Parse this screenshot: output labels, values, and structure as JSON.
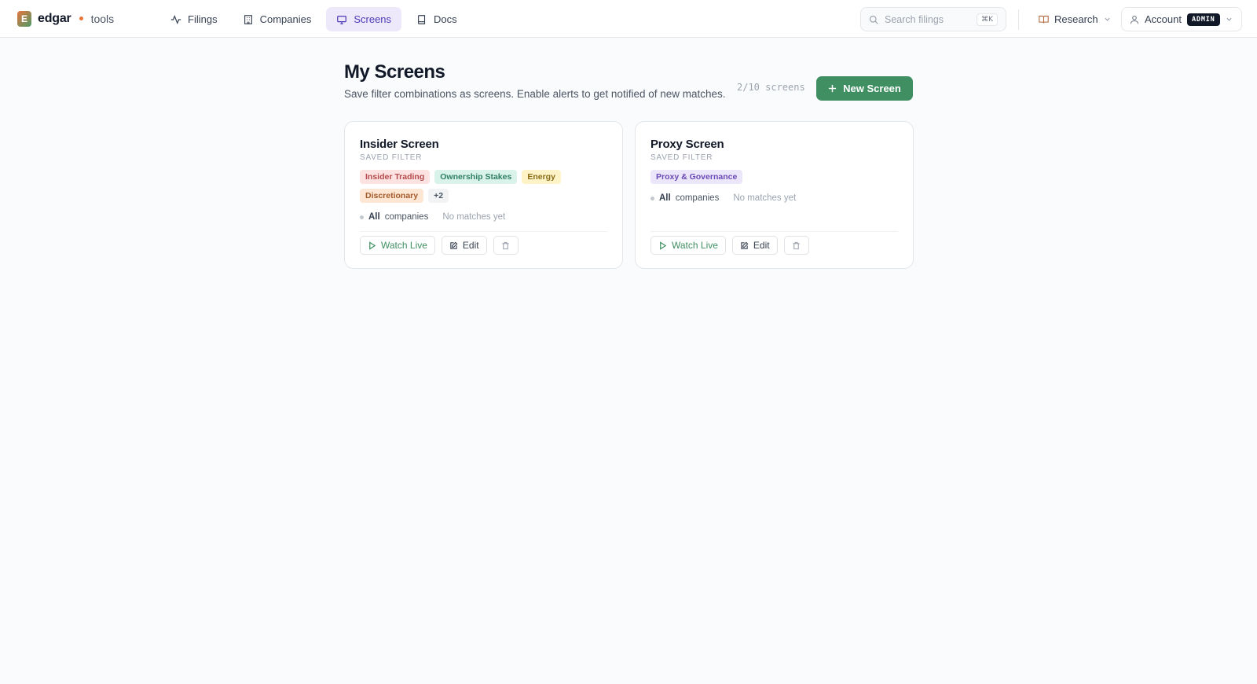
{
  "brand": {
    "mark": "E",
    "name": "edgar",
    "sub": "tools",
    "accent": "#e8743b"
  },
  "nav": {
    "items": [
      {
        "label": "Filings",
        "icon": "activity-icon"
      },
      {
        "label": "Companies",
        "icon": "building-icon"
      },
      {
        "label": "Screens",
        "icon": "monitor-icon",
        "active": true
      },
      {
        "label": "Docs",
        "icon": "book-icon"
      }
    ],
    "active_color": "#4c3ab7"
  },
  "search": {
    "placeholder": "Search filings",
    "shortcut": "⌘K"
  },
  "research": {
    "label": "Research"
  },
  "account": {
    "label": "Account",
    "badge": "ADMIN"
  },
  "page": {
    "title": "My Screens",
    "subtitle": "Save filter combinations as screens. Enable alerts to get notified of new matches.",
    "count": "2/10 screens",
    "new_button": "New Screen",
    "button_color": "#3f8f62"
  },
  "cards": [
    {
      "title": "Insider Screen",
      "kicker": "SAVED FILTER",
      "tags": [
        "Insider Trading",
        "Ownership Stakes",
        "Energy",
        "Discretionary",
        "+2"
      ],
      "scope_bold": "All",
      "scope_rest": "companies",
      "matches": "No matches yet",
      "watch_label": "Watch Live",
      "edit_label": "Edit"
    },
    {
      "title": "Proxy Screen",
      "kicker": "SAVED FILTER",
      "tags": [
        "Proxy & Governance"
      ],
      "scope_bold": "All",
      "scope_rest": "companies",
      "matches": "No matches yet",
      "watch_label": "Watch Live",
      "edit_label": "Edit"
    }
  ]
}
